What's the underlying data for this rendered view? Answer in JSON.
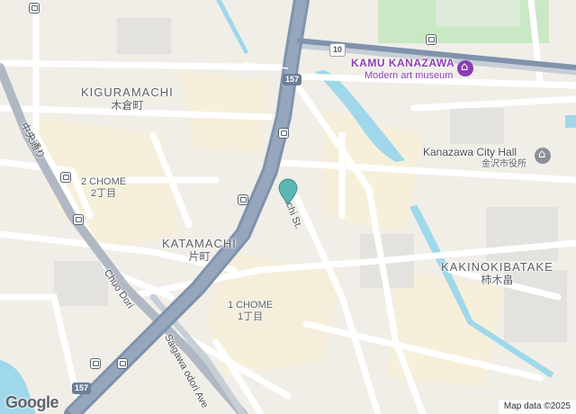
{
  "map": {
    "districts": [
      {
        "en": "KIGURAMACHI",
        "jp": "木倉町"
      },
      {
        "en": "KATAMACHI",
        "jp": "片町"
      },
      {
        "en": "KAKINOKIBATAKE",
        "jp": "柿木畠"
      }
    ],
    "chome": [
      {
        "en": "2 CHOME",
        "jp": "2丁目"
      },
      {
        "en": "1 CHOME",
        "jp": "1丁目"
      }
    ],
    "pois": {
      "museum_name": "KAMU KANAZAWA",
      "museum_sub": "Modern art museum",
      "cityhall_name": "Kanazawa City Hall",
      "cityhall_sub": "金沢市役所"
    },
    "streets": {
      "chuo_en": "Chuo Dori",
      "chuo_jp": "中央通り",
      "saigawa": "Saigawa odori Ave",
      "machi": "achi St."
    },
    "route_shields": [
      "157",
      "10",
      "157"
    ],
    "colors": {
      "highway": "#7f93ad",
      "water": "#9fd8ea",
      "park": "#c9e8c4",
      "museum": "#8b3fb3",
      "pin": "#5cb6b2"
    }
  },
  "footer": {
    "logo": "Google",
    "attribution": "Map data ©2025"
  }
}
